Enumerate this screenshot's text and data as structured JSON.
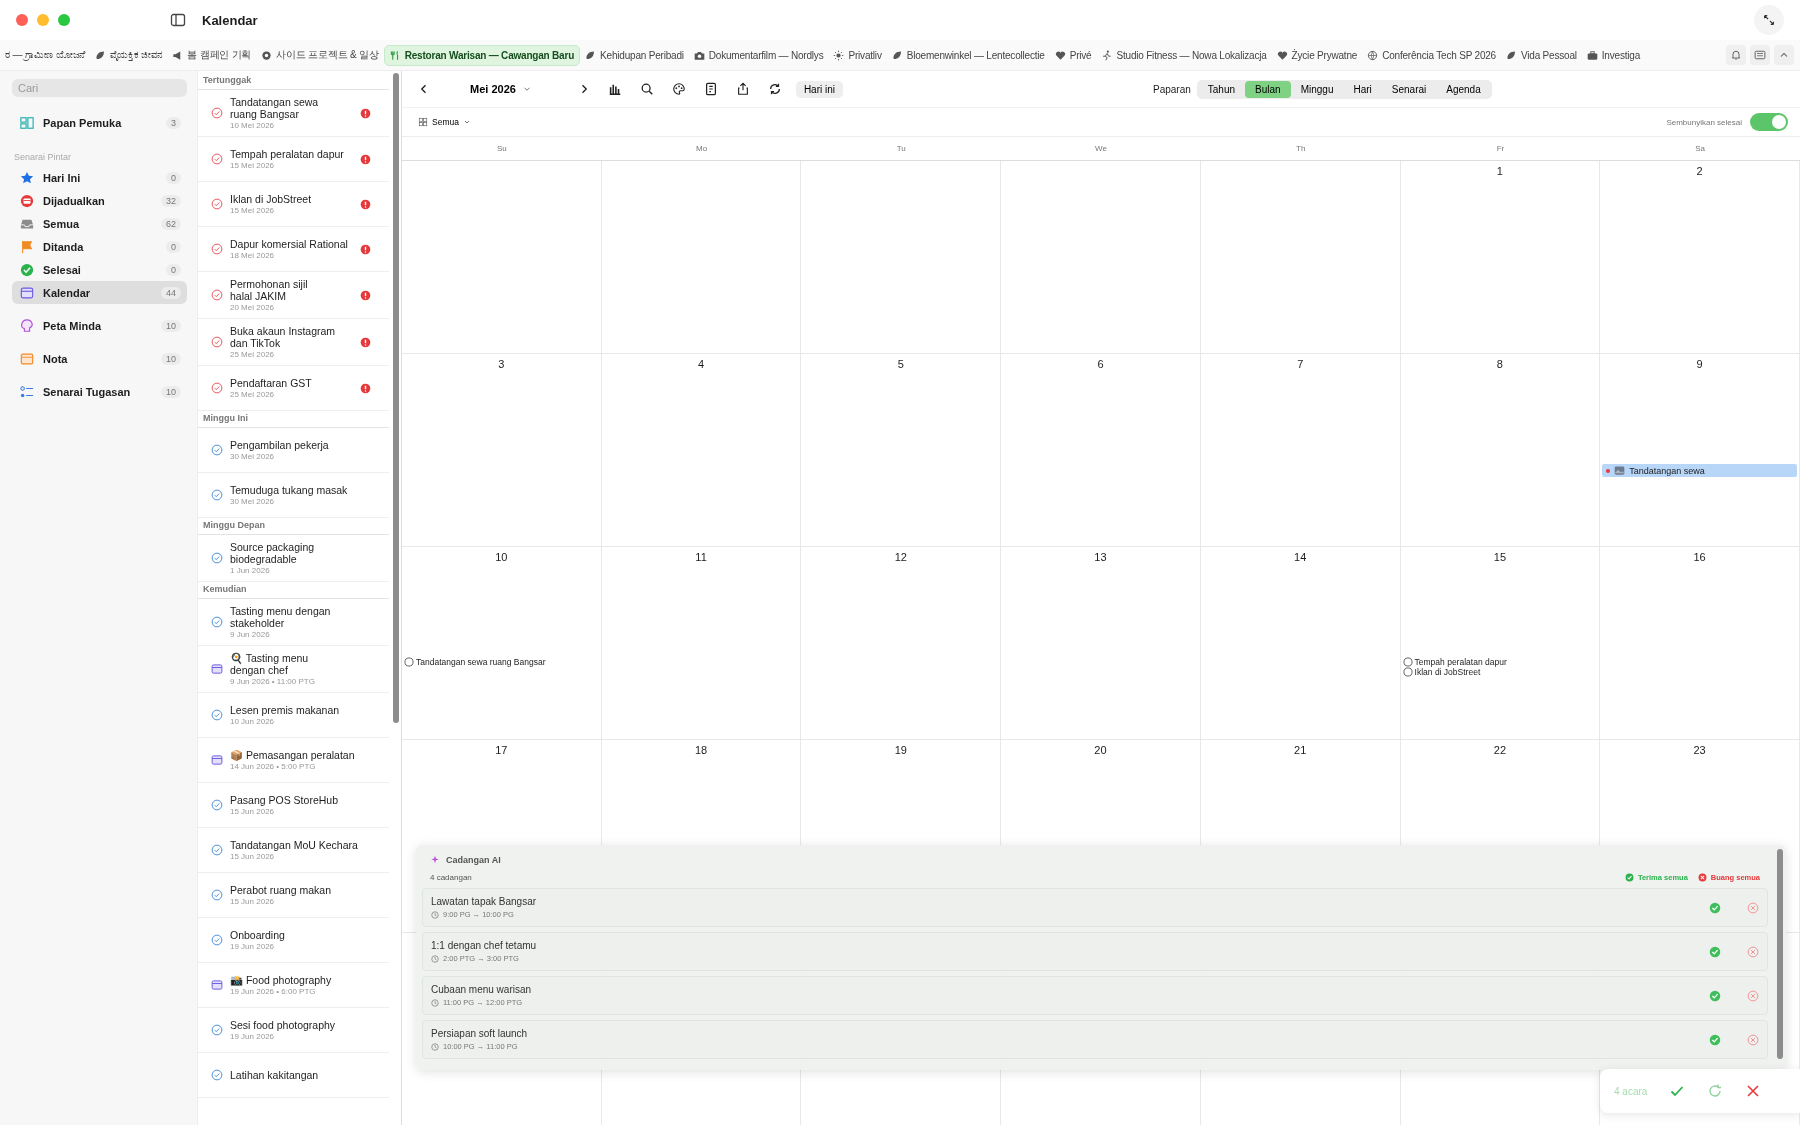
{
  "window": {
    "title": "Kalendar"
  },
  "tabs": [
    {
      "label": "ರ — ಗ್ರಾಮೀಣ ಯೋಜನೆ",
      "selected": false
    },
    {
      "label": "ವೈಯಕ್ತಿಕ ಜೀವನ",
      "selected": false
    },
    {
      "label": "봄 캠페인 기획",
      "selected": false
    },
    {
      "label": "사이드 프로젝트 & 일상",
      "selected": false
    },
    {
      "label": "Restoran Warisan — Cawangan Baru",
      "selected": true
    },
    {
      "label": "Kehidupan Peribadi",
      "selected": false
    },
    {
      "label": "Dokumentarfilm — Nordlys",
      "selected": false
    },
    {
      "label": "Privatliv",
      "selected": false
    },
    {
      "label": "Bloemenwinkel — Lentecollectie",
      "selected": false
    },
    {
      "label": "Privé",
      "selected": false
    },
    {
      "label": "Studio Fitness — Nowa Lokalizacja",
      "selected": false
    },
    {
      "label": "Życie Prywatne",
      "selected": false
    },
    {
      "label": "Conferência Tech SP 2026",
      "selected": false
    },
    {
      "label": "Vida Pessoal",
      "selected": false
    },
    {
      "label": "Investiga",
      "selected": false
    }
  ],
  "sidebar": {
    "search": {
      "placeholder": "Cari"
    },
    "sections": [
      {
        "items": [
          {
            "label": "Papan Pemuka",
            "count": "3",
            "selected": false
          }
        ]
      },
      {
        "heading": "Senarai Pintar",
        "items": [
          {
            "label": "Hari Ini",
            "count": "0",
            "selected": false
          },
          {
            "label": "Dijadualkan",
            "count": "32",
            "selected": false
          },
          {
            "label": "Semua",
            "count": "62",
            "selected": false
          },
          {
            "label": "Ditanda",
            "count": "0",
            "selected": false
          },
          {
            "label": "Selesai",
            "count": "0",
            "selected": false
          },
          {
            "label": "Kalendar",
            "count": "44",
            "selected": true
          }
        ]
      },
      {
        "items": [
          {
            "label": "Peta Minda",
            "count": "10",
            "selected": false
          }
        ]
      },
      {
        "items": [
          {
            "label": "Nota",
            "count": "10",
            "selected": false
          }
        ]
      },
      {
        "items": [
          {
            "label": "Senarai Tugasan",
            "count": "10",
            "selected": false
          }
        ]
      }
    ]
  },
  "task_list": {
    "sections": [
      {
        "heading": "Tertunggak",
        "items": [
          {
            "kind": "task",
            "title": "Tandatangan sewa\nruang Bangsar",
            "date": "10 Mei 2026",
            "overdue": true
          },
          {
            "kind": "task",
            "title": "Tempah peralatan dapur",
            "date": "15 Mei 2026",
            "overdue": true
          },
          {
            "kind": "task",
            "title": "Iklan di JobStreet",
            "date": "15 Mei 2026",
            "overdue": true
          },
          {
            "kind": "task",
            "title": "Dapur komersial Rational",
            "date": "18 Mei 2026",
            "overdue": true
          },
          {
            "kind": "task",
            "title": "Permohonan sijil\nhalal JAKIM",
            "date": "20 Mei 2026",
            "overdue": true
          },
          {
            "kind": "task",
            "title": "Buka akaun Instagram\ndan TikTok",
            "date": "25 Mei 2026",
            "overdue": true
          },
          {
            "kind": "task",
            "title": "Pendaftaran GST",
            "date": "25 Mei 2026",
            "overdue": true
          }
        ]
      },
      {
        "heading": "Minggu Ini",
        "items": [
          {
            "kind": "task",
            "title": "Pengambilan pekerja",
            "date": "30 Mei 2026",
            "overdue": false
          },
          {
            "kind": "task",
            "title": "Temuduga tukang masak",
            "date": "30 Mei 2026",
            "overdue": false
          }
        ]
      },
      {
        "heading": "Minggu Depan",
        "items": [
          {
            "kind": "task",
            "title": "Source packaging\nbiodegradable",
            "date": "1 Jun 2026",
            "overdue": false
          }
        ]
      },
      {
        "heading": "Kemudian",
        "items": [
          {
            "kind": "task",
            "title": "Tasting menu dengan\nstakeholder",
            "date": "9 Jun 2026",
            "overdue": false
          },
          {
            "kind": "event",
            "title": "🍳 Tasting menu\ndengan chef",
            "date": "9 Jun 2026 • 11:00 PTG",
            "overdue": false
          },
          {
            "kind": "task",
            "title": "Lesen premis makanan",
            "date": "10 Jun 2026",
            "overdue": false
          },
          {
            "kind": "event",
            "title": "📦 Pemasangan peralatan",
            "date": "14 Jun 2026 • 5:00 PTG",
            "overdue": false
          },
          {
            "kind": "task",
            "title": "Pasang POS StoreHub",
            "date": "15 Jun 2026",
            "overdue": false
          },
          {
            "kind": "task",
            "title": "Tandatangan MoU Kechara",
            "date": "15 Jun 2026",
            "overdue": false
          },
          {
            "kind": "task",
            "title": "Perabot ruang makan",
            "date": "15 Jun 2026",
            "overdue": false
          },
          {
            "kind": "task",
            "title": "Onboarding",
            "date": "19 Jun 2026",
            "overdue": false
          },
          {
            "kind": "event",
            "title": "📸 Food photography",
            "date": "19 Jun 2026 • 6:00 PTG",
            "overdue": false
          },
          {
            "kind": "task",
            "title": "Sesi food photography",
            "date": "19 Jun 2026",
            "overdue": false
          },
          {
            "kind": "task",
            "title": "Latihan kakitangan",
            "overdue": false
          }
        ]
      }
    ]
  },
  "calendar": {
    "month": "Mei 2026",
    "today_button": "Hari ini",
    "view_label": "Paparan",
    "views": [
      {
        "label": "Tahun",
        "selected": false
      },
      {
        "label": "Bulan",
        "selected": true
      },
      {
        "label": "Minggu",
        "selected": false
      },
      {
        "label": "Hari",
        "selected": false
      },
      {
        "label": "Senarai",
        "selected": false
      },
      {
        "label": "Agenda",
        "selected": false
      }
    ],
    "filter": "Semua",
    "hide_completed": {
      "label": "Sembunyikan selesai",
      "on": true
    },
    "weekdays": [
      "Su",
      "Mo",
      "Tu",
      "We",
      "Th",
      "Fr",
      "Sa"
    ],
    "weeks": [
      [
        {
          "day": "1"
        },
        {
          "day": "2"
        }
      ],
      [
        {
          "day": "3"
        },
        {
          "day": "4"
        },
        {
          "day": "5"
        },
        {
          "day": "6"
        },
        {
          "day": "7"
        },
        {
          "day": "8"
        },
        {
          "day": "9",
          "events": [
            {
              "kind": "bar",
              "title": "Tandatangan sewa"
            }
          ]
        }
      ],
      [
        {
          "day": "10",
          "events": [
            {
              "kind": "task",
              "title": "Tandatangan sewa ruang Bangsar"
            }
          ]
        },
        {
          "day": "11"
        },
        {
          "day": "12"
        },
        {
          "day": "13"
        },
        {
          "day": "14"
        },
        {
          "day": "15",
          "events": [
            {
              "kind": "task",
              "title": "Tempah peralatan dapur"
            },
            {
              "kind": "task",
              "title": "Iklan di JobStreet"
            }
          ]
        },
        {
          "day": "16"
        }
      ],
      [
        {
          "day": "17"
        },
        {
          "day": "18"
        },
        {
          "day": "19"
        },
        {
          "day": "20"
        },
        {
          "day": "21"
        },
        {
          "day": "22"
        },
        {
          "day": "23"
        }
      ]
    ]
  },
  "ai_panel": {
    "title": "Cadangan AI",
    "count": "4 cadangan",
    "accept_all": "Terima semua",
    "discard_all": "Buang semua",
    "suggestions": [
      {
        "title": "Lawatan tapak Bangsar",
        "time": "9:00 PG → 10:00 PG"
      },
      {
        "title": "1:1 dengan chef tetamu",
        "time": "2:00 PTG → 3:00 PTG"
      },
      {
        "title": "Cubaan menu warisan",
        "time": "11:00 PG → 12:00 PTG"
      },
      {
        "title": "Persiapan soft launch",
        "time": "10:00 PG → 11:00 PG"
      }
    ]
  },
  "floating_bar": {
    "count": "4 acara"
  }
}
